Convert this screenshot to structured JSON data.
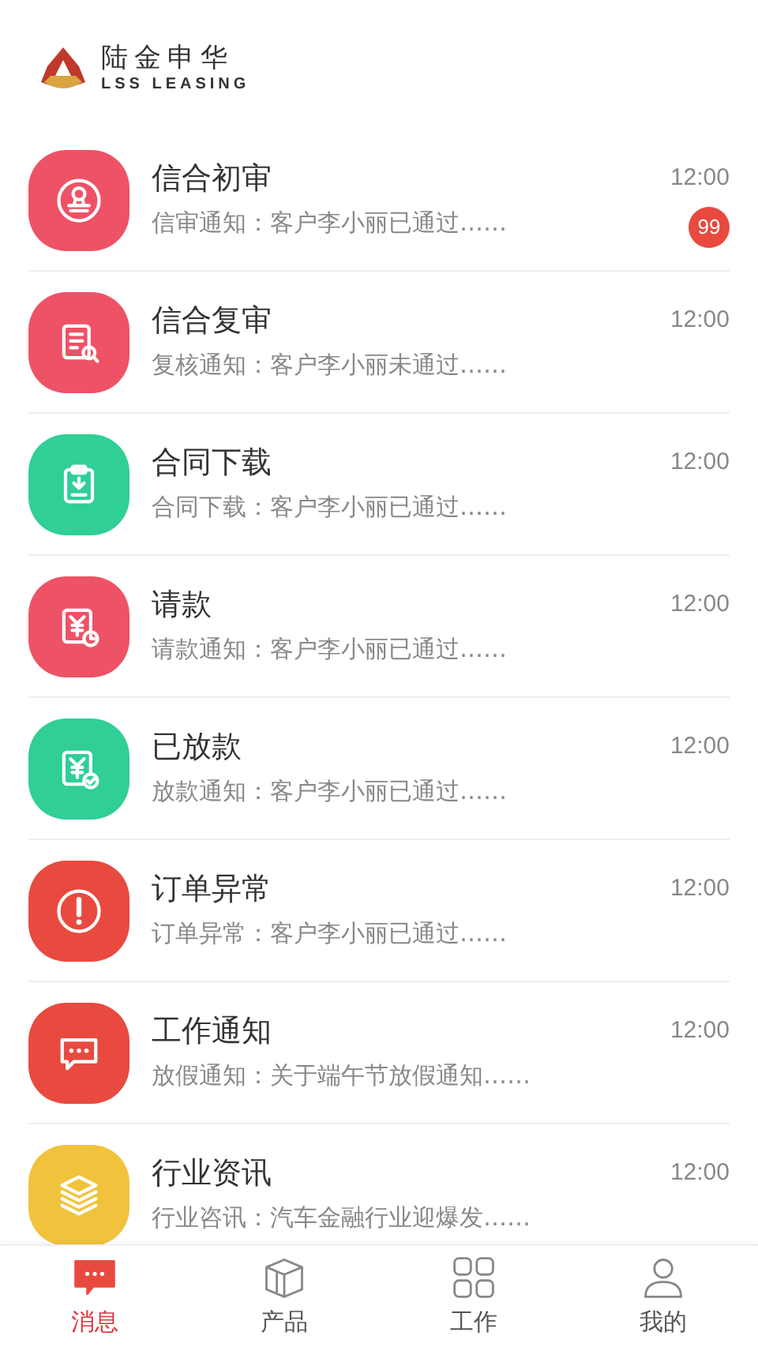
{
  "brand": {
    "name": "陆金申华",
    "tagline": "LSS LEASING"
  },
  "messages": [
    {
      "kind": "stamp",
      "color": "#ee5267",
      "title": "信合初审",
      "preview": "信审通知：客户李小丽已通过……",
      "time": "12:00",
      "badge": "99"
    },
    {
      "kind": "document-search",
      "color": "#ee5267",
      "title": "信合复审",
      "preview": "复核通知：客户李小丽未通过……",
      "time": "12:00"
    },
    {
      "kind": "clipboard-download",
      "color": "#2fcf96",
      "title": "合同下载",
      "preview": "合同下载：客户李小丽已通过……",
      "time": "12:00"
    },
    {
      "kind": "yen-clock",
      "color": "#ee5267",
      "title": "请款",
      "preview": "请款通知：客户李小丽已通过……",
      "time": "12:00"
    },
    {
      "kind": "yen-check",
      "color": "#2fcf96",
      "title": "已放款",
      "preview": "放款通知：客户李小丽已通过……",
      "time": "12:00"
    },
    {
      "kind": "alert",
      "color": "#e84a3f",
      "title": "订单异常",
      "preview": "订单异常：客户李小丽已通过……",
      "time": "12:00"
    },
    {
      "kind": "chat",
      "color": "#e84a3f",
      "title": "工作通知",
      "preview": "放假通知：关于端午节放假通知……",
      "time": "12:00"
    },
    {
      "kind": "layers",
      "color": "#f1c33c",
      "title": "行业资讯",
      "preview": "行业咨讯：汽车金融行业迎爆发……",
      "time": "12:00"
    }
  ],
  "tab_bar": [
    {
      "kind": "chat",
      "label": "消息",
      "selected": true
    },
    {
      "kind": "box",
      "label": "产品",
      "selected": false
    },
    {
      "kind": "grid",
      "label": "工作",
      "selected": false
    },
    {
      "kind": "person",
      "label": "我的",
      "selected": false
    }
  ]
}
